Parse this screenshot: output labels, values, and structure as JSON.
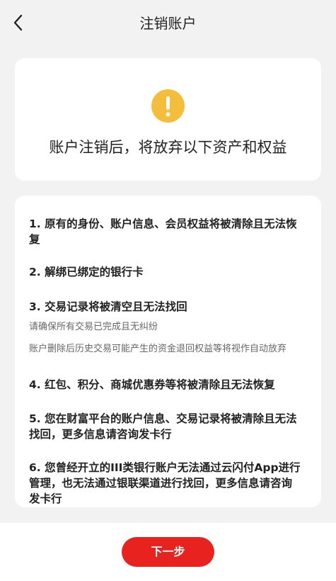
{
  "header": {
    "title": "注销账户",
    "back_icon": "chevron-left-icon"
  },
  "warning": {
    "icon": "exclamation-circle-icon",
    "icon_color": "#f5bd3c",
    "text": "账户注销后，将放弃以下资产和权益"
  },
  "items": [
    {
      "line1": "1. 原有的身份、账户信息、会员权益将被清除且无法恢",
      "line2": "复"
    },
    {
      "line1": "2. 解绑已绑定的银行卡"
    },
    {
      "line1": "3. 交易记录将被清空且无法找回",
      "notes": [
        "请确保所有交易已完成且无纠纷",
        "账户删除后历史交易可能产生的资金退回权益等将视作自动放弃"
      ]
    },
    {
      "line1": "4. 红包、积分、商城优惠券等将被清除且无法恢复"
    },
    {
      "line1": "5. 您在财富平台的账户信息、交易记录将被清除且无法",
      "line2": "找回，更多信息请咨询发卡行"
    },
    {
      "line1": "6. 您曾经开立的III类银行账户无法通过云闪付App进行",
      "line2": "管理，也无法通过银联渠道进行找回，更多信息请咨询",
      "line3": "发卡行"
    }
  ],
  "footer": {
    "next_label": "下一步",
    "button_color": "#e8221f"
  }
}
